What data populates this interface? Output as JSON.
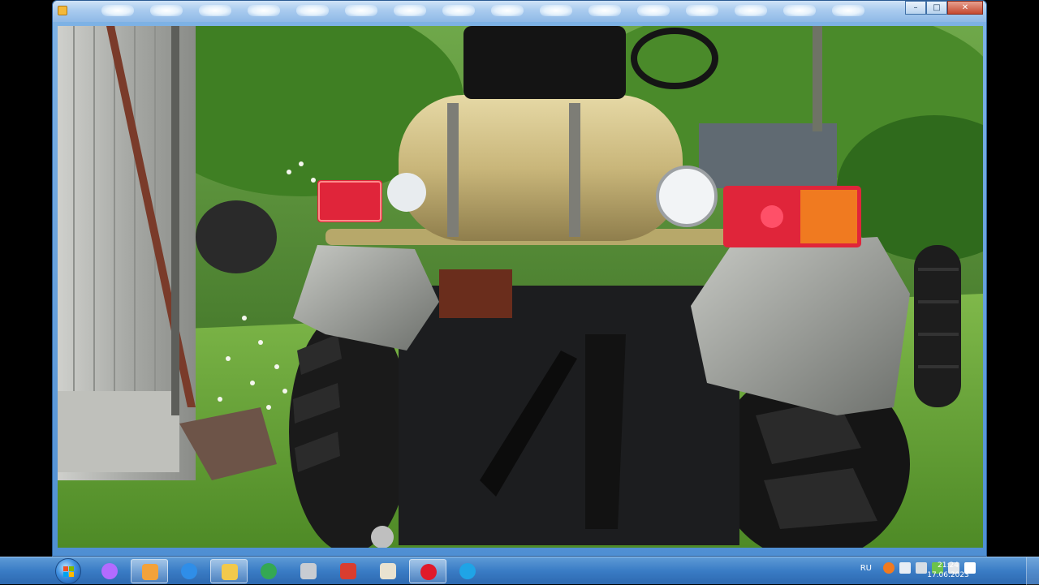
{
  "window": {
    "title_icon": "media-player-icon",
    "controls": {
      "minimize": "–",
      "maximize": "□",
      "close": "✕"
    }
  },
  "photo": {
    "subject": "rear-of-homemade-tractor",
    "colors": {
      "grass": "#4e8a26",
      "foliage": "#2f6a1c",
      "tank": "#c9b67a",
      "body": "#1c1d1f",
      "light_red": "#e0253a",
      "light_amber": "#f07a20"
    }
  },
  "taskbar": {
    "items": [
      {
        "name": "alice-assistant",
        "icon": "assistant-icon",
        "color": "#b36bff",
        "active": false
      },
      {
        "name": "media-player",
        "icon": "media-player-icon",
        "color": "#f3a23a",
        "active": true
      },
      {
        "name": "internet-explorer",
        "icon": "ie-icon",
        "color": "#2f8ee8",
        "active": false
      },
      {
        "name": "file-explorer",
        "icon": "folder-icon",
        "color": "#f2c94c",
        "active": true
      },
      {
        "name": "chrome",
        "icon": "chrome-icon",
        "color": "#34a853",
        "active": false
      },
      {
        "name": "calculator",
        "icon": "calculator-icon",
        "color": "#c8ccd2",
        "active": false
      },
      {
        "name": "pdf-reader",
        "icon": "pdf-icon",
        "color": "#d93d2f",
        "active": false
      },
      {
        "name": "paint",
        "icon": "paint-icon",
        "color": "#e9e2d0",
        "active": false
      },
      {
        "name": "opera",
        "icon": "opera-icon",
        "color": "#e01a2b",
        "active": true
      },
      {
        "name": "skype",
        "icon": "skype-icon",
        "color": "#1fa4e6",
        "active": false
      }
    ],
    "tray": {
      "language": "RU",
      "icons": [
        "avast-icon",
        "speaker-icon",
        "network-icon",
        "battery-icon",
        "safely-remove-icon",
        "flag-icon"
      ],
      "time": "21:24",
      "date": "17.06.2023"
    }
  }
}
